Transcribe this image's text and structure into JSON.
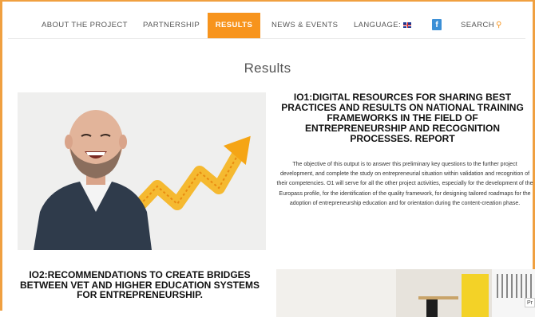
{
  "nav": {
    "items": [
      {
        "label": "ABOUT THE PROJECT"
      },
      {
        "label": "PARTNERSHIP"
      },
      {
        "label": "RESULTS"
      },
      {
        "label": "NEWS & EVENTS"
      },
      {
        "label": "LANGUAGE:"
      },
      {
        "label": "SEARCH"
      }
    ],
    "active": "RESULTS",
    "facebook_letter": "f",
    "language_flag_icon": "uk-flag-icon",
    "search_icon": "search-icon",
    "accent_color": "#f7941d"
  },
  "page": {
    "title": "Results"
  },
  "io1": {
    "title": "IO1:DIGITAL RESOURCES FOR SHARING BEST PRACTICES AND RESULTS ON NATIONAL TRAINING FRAMEWORKS IN THE FIELD OF ENTREPRENEURSHIP AND RECOGNITION PROCESSES. REPORT",
    "text": "The objective of this output is to answer this preliminary key questions to the further project development, and complete the study on entrepreneurial situation within validation and recognition of their competencies. O1 will serve for all the other project activities, especially for the development of the Europass profile, for the identification of the quality framework, for designing tailored roadmaps for the adoption of entrepreneurship education and for orientation during the content-creation phase."
  },
  "io2": {
    "title": "IO2:RECOMMENDATIONS TO CREATE BRIDGES BETWEEN VET AND HIGHER EDUCATION SYSTEMS FOR ENTREPRENEURSHIP."
  },
  "corner_tag": "Pr"
}
